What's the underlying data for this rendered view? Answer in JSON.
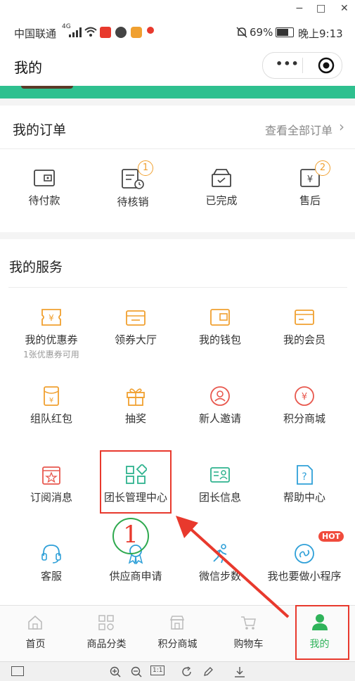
{
  "window": {
    "minimize": "−",
    "maximize": "□",
    "close": "✕"
  },
  "statusbar": {
    "carrier": "中国联通",
    "signal_type": "4G",
    "battery": "69%",
    "time": "晚上9:13"
  },
  "title": "我的",
  "capsule": {
    "more_icon": "•••"
  },
  "orders": {
    "title": "我的订单",
    "view_all": "查看全部订单",
    "items": [
      {
        "label": "待付款",
        "icon": "wallet-icon",
        "badge": ""
      },
      {
        "label": "待核销",
        "icon": "receipt-clock-icon",
        "badge": "1"
      },
      {
        "label": "已完成",
        "icon": "box-check-icon",
        "badge": ""
      },
      {
        "label": "售后",
        "icon": "yen-box-icon",
        "badge": "2"
      }
    ]
  },
  "services": {
    "title": "我的服务",
    "items": [
      {
        "label": "我的优惠券",
        "sub": "1张优惠券可用",
        "icon": "coupon-icon",
        "color": "#f0a030"
      },
      {
        "label": "领券大厅",
        "sub": "",
        "icon": "coupon-hall-icon",
        "color": "#f0a030"
      },
      {
        "label": "我的钱包",
        "sub": "",
        "icon": "wallet-icon",
        "color": "#f0a030"
      },
      {
        "label": "我的会员",
        "sub": "",
        "icon": "member-card-icon",
        "color": "#f0a030"
      },
      {
        "label": "组队红包",
        "sub": "",
        "icon": "red-packet-icon",
        "color": "#f0a030"
      },
      {
        "label": "抽奖",
        "sub": "",
        "icon": "gift-icon",
        "color": "#f0a030"
      },
      {
        "label": "新人邀请",
        "sub": "",
        "icon": "invite-user-icon",
        "color": "#e8584e"
      },
      {
        "label": "积分商城",
        "sub": "",
        "icon": "yen-circle-icon",
        "color": "#e8584e"
      },
      {
        "label": "订阅消息",
        "sub": "",
        "icon": "subscribe-star-icon",
        "color": "#e8584e"
      },
      {
        "label": "团长管理中心",
        "sub": "",
        "icon": "grid-manage-icon",
        "color": "#2fb38f"
      },
      {
        "label": "团长信息",
        "sub": "",
        "icon": "id-card-icon",
        "color": "#2fb38f"
      },
      {
        "label": "帮助中心",
        "sub": "",
        "icon": "help-doc-icon",
        "color": "#2fa0d8"
      },
      {
        "label": "客服",
        "sub": "",
        "icon": "headset-icon",
        "color": "#2fa0d8"
      },
      {
        "label": "供应商申请",
        "sub": "",
        "icon": "award-icon",
        "color": "#2fa0d8"
      },
      {
        "label": "微信步数",
        "sub": "",
        "icon": "running-icon",
        "color": "#2fa0d8"
      },
      {
        "label": "我也要做小程序",
        "sub": "",
        "icon": "miniprogram-icon",
        "color": "#2fa0d8"
      }
    ],
    "hot_badge": "HOT"
  },
  "annotation": {
    "number": "1"
  },
  "tabbar": [
    {
      "label": "首页",
      "icon": "home-icon",
      "active": false
    },
    {
      "label": "商品分类",
      "icon": "category-icon",
      "active": false
    },
    {
      "label": "积分商城",
      "icon": "shop-icon",
      "active": false
    },
    {
      "label": "购物车",
      "icon": "cart-icon",
      "active": false
    },
    {
      "label": "我的",
      "icon": "user-icon",
      "active": true
    }
  ],
  "toolbar": {
    "page_indicator": "1:1"
  }
}
